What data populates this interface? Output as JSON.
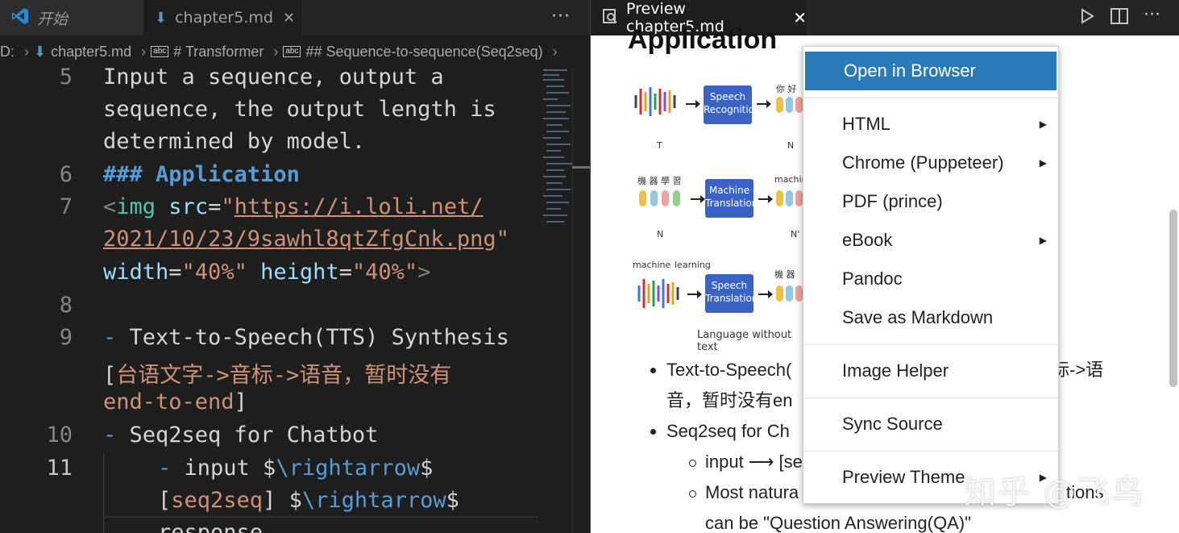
{
  "editor": {
    "tabs": [
      {
        "label": "开始",
        "icon": "vscode-logo-icon"
      },
      {
        "label": "chapter5.md",
        "icon": "markdown-icon"
      }
    ],
    "more_label": "···",
    "breadcrumb": [
      "D:",
      "chapter5.md",
      "# Transformer",
      "## Sequence-to-sequence(Seq2seq)"
    ],
    "lines": {
      "n5": "5",
      "l5a": "Input a sequence, output a",
      "l5b": "sequence, the output length is",
      "l5c": "determined by model.",
      "n6": "6",
      "l6": "### Application",
      "n7": "7",
      "l7_lt": "<",
      "l7_tag": "img",
      "l7_attr": " src",
      "l7_eq": "=",
      "l7_q": "\"",
      "l7_url1": "https://i.loli.net/",
      "l7_url2": "2021/10/23/9sawhl8qtZfgCnk.png",
      "l7_q2": "\"",
      "l7_w": "width",
      "l7_wv": "\"40%\"",
      "l7_h": " height",
      "l7_hv": "\"40%\"",
      "l7_gt": ">",
      "n8": "8",
      "n9": "9",
      "l9_dash": "- ",
      "l9a": "Text-to-Speech(TTS) Synthesis",
      "l9b_open": "[",
      "l9b_text": "台语文字->音标->语音，暂时没有",
      "l9c_text": "end-to-end",
      "l9c_close": "]",
      "n10": "10",
      "l10_dash": "- ",
      "l10": "Seq2seq for Chatbot",
      "n11": "11",
      "l11_dash": "- ",
      "l11a": "input $",
      "l11a_cmd": "\\rightarrow",
      "l11a_end": "$",
      "l11b_open": "[",
      "l11b_text": "seq2seq",
      "l11b_close": "] $",
      "l11b_cmd": "\\rightarrow",
      "l11b_end": "$",
      "l11c": "response"
    }
  },
  "preview": {
    "tab_label": "Preview chapter5.md",
    "heading": "Application",
    "diagram": {
      "box1": "Speech Recognition",
      "box2": "Machine Translation",
      "box3": "Speech Translation",
      "t": "T",
      "n": "N",
      "n2": "N",
      "n3": "N'",
      "machine1": "machine",
      "machine2": "machine",
      "learning": "learning",
      "caption": "Language without text",
      "chars1": "你 好",
      "chars2": "機 器 學 習",
      "chars3": "機 器"
    },
    "bullets": {
      "b1a": "Text-to-Speech(",
      "b1a_end": "标->语",
      "b1b": "音，暂时没有en",
      "b2": "Seq2seq for Ch",
      "s1": "input ⟶ [se",
      "s2": "Most natura",
      "s2_end": "tions",
      "s3": "can be \"Question Answering(QA)\""
    }
  },
  "context_menu": {
    "items": [
      {
        "label": "Open in Browser",
        "submenu": false
      },
      {
        "label": "HTML",
        "submenu": true
      },
      {
        "label": "Chrome (Puppeteer)",
        "submenu": true
      },
      {
        "label": "PDF (prince)",
        "submenu": false
      },
      {
        "label": "eBook",
        "submenu": true
      },
      {
        "label": "Pandoc",
        "submenu": false
      },
      {
        "label": "Save as Markdown",
        "submenu": false
      },
      {
        "label": "Image Helper",
        "submenu": false
      },
      {
        "label": "Sync Source",
        "submenu": false
      },
      {
        "label": "Preview Theme",
        "submenu": true
      }
    ]
  },
  "watermark": "知乎 @飞鸟"
}
